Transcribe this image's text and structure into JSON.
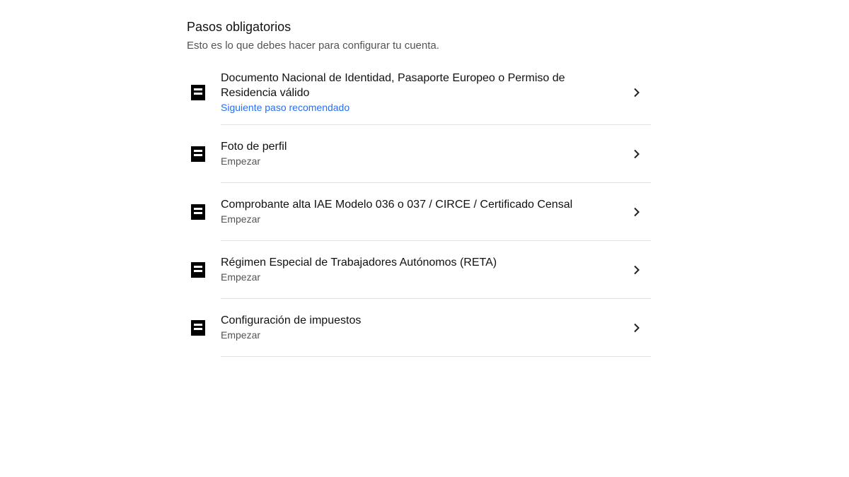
{
  "section": {
    "title": "Pasos obligatorios",
    "subtitle": "Esto es lo que debes hacer para configurar tu cuenta."
  },
  "colors": {
    "recommended": "#276ef1",
    "divider": "#e2e2e2",
    "secondary_text": "#545454"
  },
  "steps": [
    {
      "icon": "document-icon",
      "title": "Documento Nacional de Identidad, Pasaporte Europeo o Permiso de Residencia válido",
      "status": "Siguiente paso recomendado",
      "recommended": true
    },
    {
      "icon": "document-icon",
      "title": "Foto de perfil",
      "status": "Empezar",
      "recommended": false
    },
    {
      "icon": "document-icon",
      "title": "Comprobante alta IAE Modelo 036 o 037 / CIRCE / Certificado Censal",
      "status": "Empezar",
      "recommended": false
    },
    {
      "icon": "document-icon",
      "title": "Régimen Especial de Trabajadores Autónomos (RETA)",
      "status": "Empezar",
      "recommended": false
    },
    {
      "icon": "document-icon",
      "title": "Configuración de impuestos",
      "status": "Empezar",
      "recommended": false
    }
  ]
}
